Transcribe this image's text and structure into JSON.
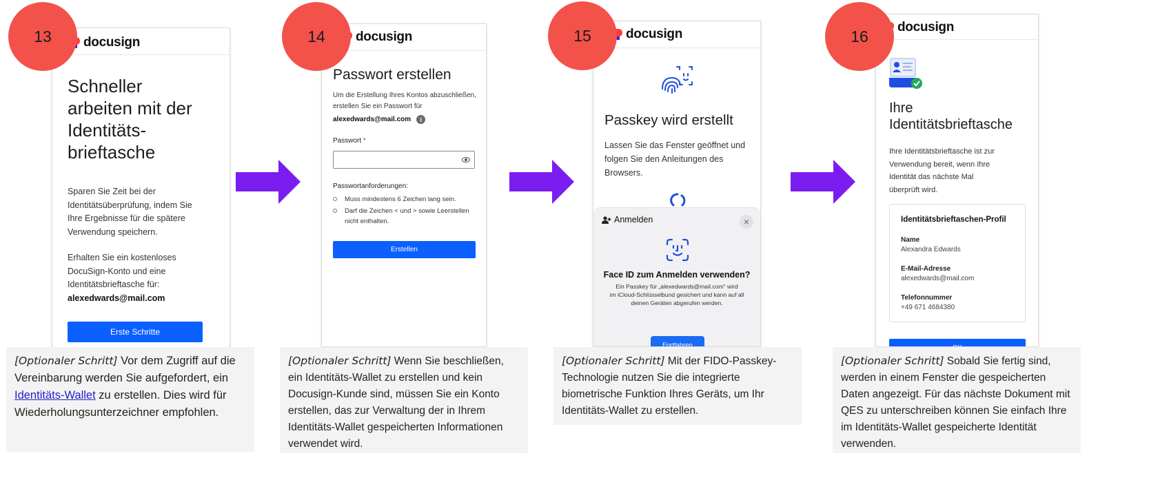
{
  "brand": "docusign",
  "colors": {
    "badge": "#f3524b",
    "arrow": "#7b1cf0",
    "button": "#0b5fff",
    "link": "#2323c7"
  },
  "steps": [
    {
      "number": "13",
      "heading_lines": [
        "Schneller",
        "arbeiten mit der",
        "Identitäts-",
        "brieftasche"
      ],
      "paragraph1_lines": [
        "Sparen Sie Zeit bei der",
        "Identitätsüberprüfung, indem Sie",
        "Ihre Ergebnisse für die spätere",
        "Verwendung speichern."
      ],
      "paragraph2_lines": [
        "Erhalten Sie ein kostenloses",
        "DocuSign-Konto und eine",
        "Identitätsbrieftasche für:"
      ],
      "email": "alexedwards@mail.com",
      "button": "Erste Schritte",
      "caption": {
        "optional": "[Optionaler Schritt]",
        "before_link": " Vor dem Zugriff auf die Vereinbarung werden Sie aufgefordert, ein ",
        "link": "Identitäts-Wallet",
        "after_link": " zu erstellen. Dies wird für Wiederholungs­unterzeichner empfohlen."
      }
    },
    {
      "number": "14",
      "heading": "Passwort erstellen",
      "intro_lines": [
        "Um die Erstellung Ihres Kontos abzuschließen,",
        "erstellen Sie ein Passwort für"
      ],
      "email": "alexedwards@mail.com",
      "info_icon": "i",
      "password_label": "Passwort",
      "required_mark": "*",
      "requirements_title": "Passwortanforderungen:",
      "requirements": [
        "Muss mindestens 6 Zeichen lang sein.",
        "Darf die Zeichen < und > sowie Leerstellen nicht enthalten."
      ],
      "button": "Erstellen",
      "caption": {
        "optional": "[Optionaler Schritt]",
        "text": " Wenn Sie beschließen, ein Identitäts-Wallet zu erstellen und kein Docusign-Kunde sind, müssen Sie ein Konto erstellen, das zur Verwaltung der in Ihrem Identitäts-Wallet gespeicherten Informationen verwendet wird."
      }
    },
    {
      "number": "15",
      "heading": "Passkey wird erstellt",
      "text_lines": [
        "Lassen Sie das Fenster geöffnet und",
        "folgen Sie den Anleitungen des",
        "Browsers."
      ],
      "dialog_title": "Anmelden",
      "close": "×",
      "dialog_heading": "Face ID zum Anmelden verwenden?",
      "dialog_text_lines": [
        "Ein Passkey für „alexedwards@mail.com“ wird",
        "im iCloud-Schlüsselbund gesichert und kann auf all",
        "deinen Geräten abgerufen werden."
      ],
      "button": "Fortfahren",
      "caption": {
        "optional": "[Optionaler Schritt]",
        "text": " Mit der FIDO-Passkey-Technologie nutzen Sie die integrierte biometrische Funktion Ihres Geräts, um Ihr Identitäts-Wallet  zu erstellen."
      }
    },
    {
      "number": "16",
      "heading_lines": [
        "Ihre",
        "Identitätsbrieftasche"
      ],
      "text_lines": [
        "Ihre Identitätsbrieftasche ist zur",
        "Verwendung bereit, wenn Ihre",
        "Identität das nächste Mal",
        "überprüft wird."
      ],
      "card_title": "Identitätsbrieftaschen-Profil",
      "fields": [
        {
          "label": "Name",
          "value": "Alexandra Edwards"
        },
        {
          "label": "E-Mail-Adresse",
          "value": "alexedwards@mail.com"
        },
        {
          "label": "Telefonnummer",
          "value": "+49 671 4684380"
        }
      ],
      "button": "OK",
      "caption": {
        "optional": "[Optionaler Schritt]",
        "text": " Sobald Sie fertig sind, werden in einem Fenster die gespeicherten Daten angezeigt. Für das nächste Dokument mit QES zu unterschreiben können Sie einfach Ihre im Identitäts-Wallet gespeicherte Identität verwenden."
      }
    }
  ]
}
